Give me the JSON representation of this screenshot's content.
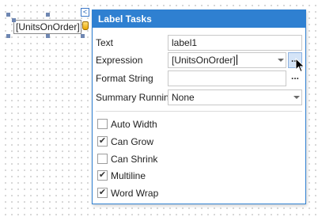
{
  "designer": {
    "label_text": "[UnitsOnOrder]",
    "smart_tag_glyph": "<",
    "db_icon": "database-icon"
  },
  "panel": {
    "title": "Label Tasks",
    "text_label": "Text",
    "text_value": "label1",
    "expression_label": "Expression",
    "expression_value": "[UnitsOnOrder]",
    "format_string_label": "Format String",
    "format_string_value": "",
    "summary_running_label": "Summary Running",
    "summary_running_value": "None",
    "ellipsis": "...",
    "options": [
      {
        "label": "Auto Width",
        "checked": false
      },
      {
        "label": "Can Grow",
        "checked": true
      },
      {
        "label": "Can Shrink",
        "checked": false
      },
      {
        "label": "Multiline",
        "checked": true
      },
      {
        "label": "Word Wrap",
        "checked": true
      }
    ],
    "accent_color": "#2f80d1"
  }
}
